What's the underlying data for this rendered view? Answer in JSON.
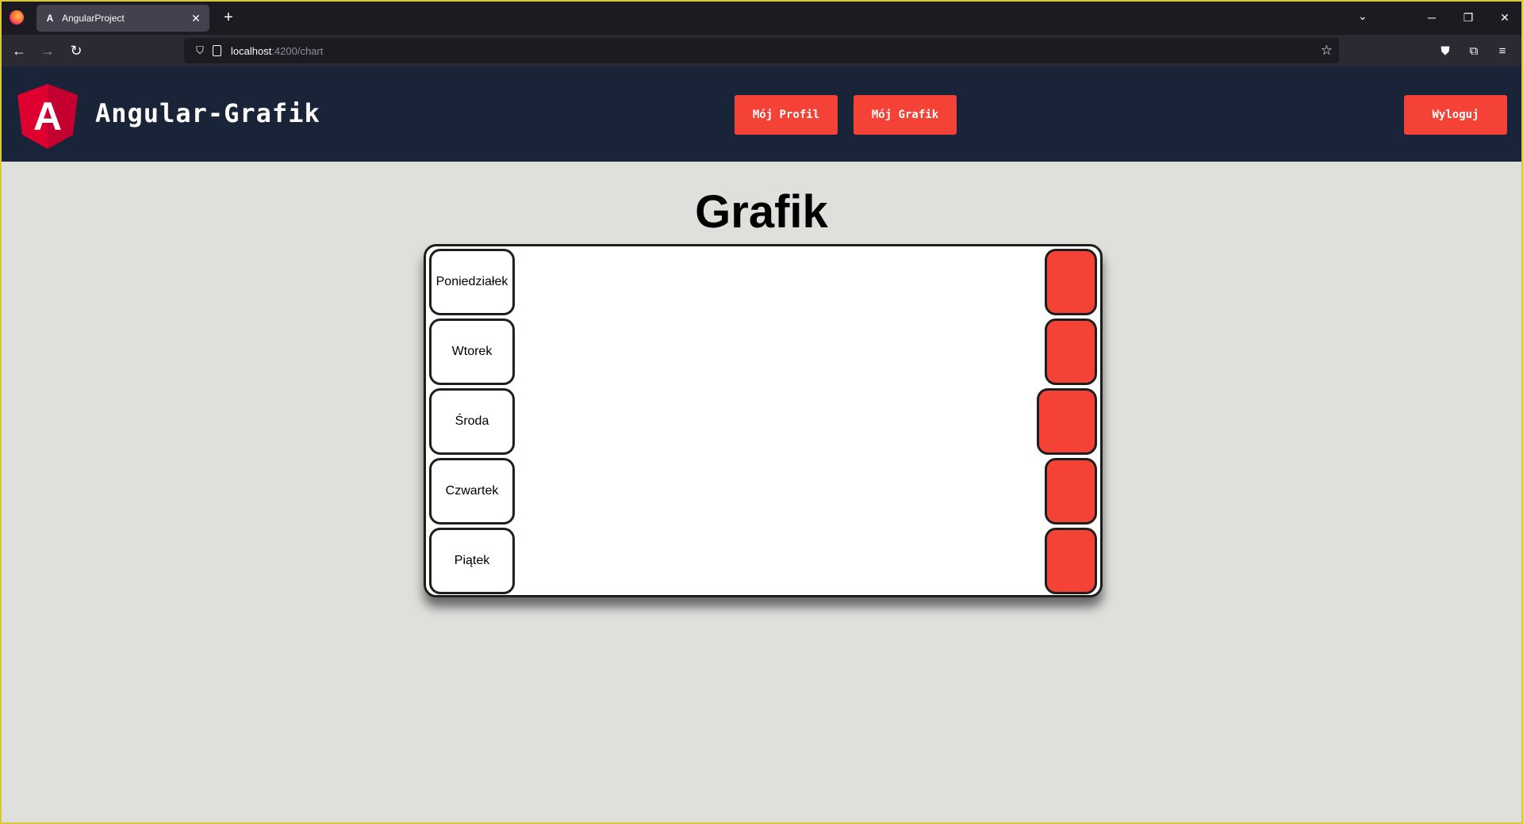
{
  "browser": {
    "tab_title": "AngularProject",
    "tab_favicon": "A",
    "url_host": "localhost",
    "url_path": ":4200/chart",
    "icons": [
      "firefox-icon",
      "close-icon",
      "new-tab-icon",
      "tab-list-icon",
      "minimize-icon",
      "restore-icon",
      "close-window-icon",
      "back-icon",
      "forward-icon",
      "reload-icon",
      "shield-icon",
      "page-icon",
      "star-icon",
      "pocket-icon",
      "extensions-icon",
      "menu-icon"
    ]
  },
  "header": {
    "app_name": "Angular-Grafik",
    "logo_letter": "A",
    "nav": {
      "profile_label": "Mój Profil",
      "schedule_label": "Mój Grafik",
      "logout_label": "Wyloguj"
    },
    "colors": {
      "background": "#1a2438",
      "accent": "#f44336"
    }
  },
  "main": {
    "title": "Grafik",
    "days": [
      {
        "label": "Poniedziałek"
      },
      {
        "label": "Wtorek"
      },
      {
        "label": "Środa"
      },
      {
        "label": "Czwartek"
      },
      {
        "label": "Piątek"
      }
    ],
    "colors": {
      "page_background": "#dfdfdc",
      "action_button": "#f44336"
    }
  }
}
